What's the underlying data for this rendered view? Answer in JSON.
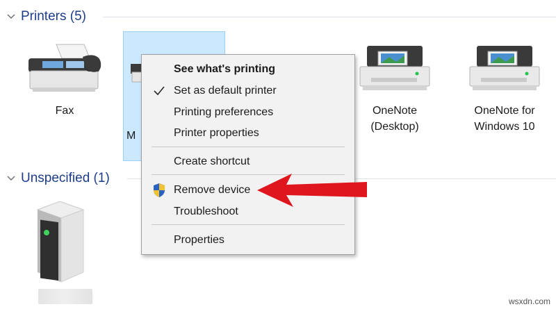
{
  "groups": {
    "printers": "Printers (5)",
    "unspecified": "Unspecified (1)"
  },
  "devices": {
    "fax": "Fax",
    "selected_partial": "M",
    "onenote_desktop": "OneNote\n(Desktop)",
    "onenote_w10": "OneNote for\nWindows 10"
  },
  "context_menu": {
    "items": [
      {
        "label": "See what's printing"
      },
      {
        "label": "Set as default printer"
      },
      {
        "label": "Printing preferences"
      },
      {
        "label": "Printer properties"
      },
      {
        "label": "Create shortcut"
      },
      {
        "label": "Remove device"
      },
      {
        "label": "Troubleshoot"
      },
      {
        "label": "Properties"
      }
    ]
  },
  "icons": {
    "group_toggle": "chevron-down-icon",
    "checkmark": "check-icon",
    "uac": "uac-shield-icon",
    "arrow": "red-pointer-arrow"
  },
  "colors": {
    "group_title": "#1e3c8c",
    "selection_fill": "#cce8ff",
    "arrow": "#e0161e",
    "menu_bg": "#f2f2f2"
  },
  "watermark": "wsxdn.com"
}
